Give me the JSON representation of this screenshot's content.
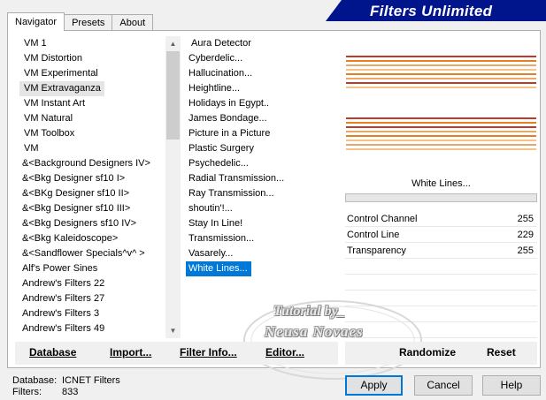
{
  "window": {
    "banner_title": "Filters Unlimited",
    "banner_color": "#00148c"
  },
  "tabs": [
    {
      "label": "Navigator",
      "active": true
    },
    {
      "label": "Presets",
      "active": false
    },
    {
      "label": "About",
      "active": false
    }
  ],
  "categories": {
    "items": [
      "VM 1",
      "VM Distortion",
      "VM Experimental",
      "VM Extravaganza",
      "VM Instant Art",
      "VM Natural",
      "VM Toolbox",
      "VM",
      "&<Background Designers IV>",
      "&<Bkg Designer sf10 I>",
      "&<BKg Designer sf10 II>",
      "&<Bkg Designer sf10 III>",
      "&<Bkg Designers sf10 IV>",
      "&<Bkg Kaleidoscope>",
      "&<Sandflower Specials^v^ >",
      "Alf's Power Sines",
      "Andrew's Filters 22",
      "Andrew's Filters 27",
      "Andrew's Filters 3",
      "Andrew's Filters 49"
    ],
    "selected": "VM Extravaganza"
  },
  "filters": {
    "items": [
      "Aura Detector",
      "Cyberdelic...",
      "Hallucination...",
      "Heightline...",
      "Holidays in Egypt..",
      "James Bondage...",
      "Picture in a Picture",
      "Plastic Surgery",
      "Psychedelic...",
      "Radial Transmission...",
      "Ray Transmission...",
      "shoutin'!...",
      "Stay In Line!",
      "Transmission...",
      "Vasarely...",
      "White Lines..."
    ],
    "selected": "White Lines..."
  },
  "preview": {
    "filter_name": "White Lines...",
    "line_colors": [
      "#c0392b",
      "#e67e22",
      "#e8a86a",
      "#f4c28a"
    ]
  },
  "controls": [
    {
      "label": "Control Channel",
      "value": "255"
    },
    {
      "label": "Control Line",
      "value": "229"
    },
    {
      "label": "Transparency",
      "value": "255"
    }
  ],
  "actions": {
    "database": "Database",
    "import": "Import...",
    "filter_info": "Filter Info...",
    "editor": "Editor...",
    "randomize": "Randomize",
    "reset": "Reset"
  },
  "footer": {
    "database_label": "Database:",
    "database_value": "ICNET Filters",
    "filters_label": "Filters:",
    "filters_value": "833"
  },
  "buttons": {
    "apply": "Apply",
    "cancel": "Cancel",
    "help": "Help"
  },
  "watermark": {
    "line1": "Tutorial by_",
    "line2": "Neusa Novaes"
  },
  "scroll_icons": {
    "up": "scroll-up-arrow-icon",
    "down": "scroll-down-arrow-icon"
  }
}
